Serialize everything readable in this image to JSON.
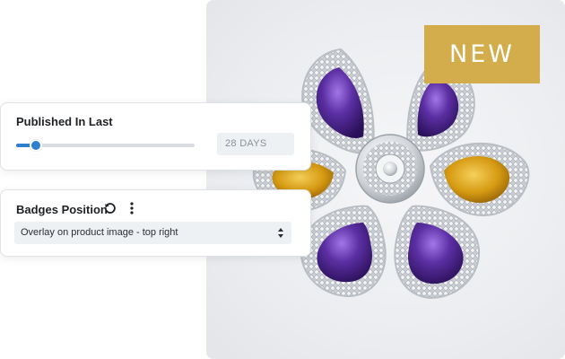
{
  "product": {
    "badge_text": "NEW"
  },
  "published_in_last": {
    "label": "Published In Last",
    "slider_value_fraction": 0.11,
    "value_text": "28 DAYS"
  },
  "badges_position": {
    "label": "Badges Position",
    "reset_icon": "reset-icon",
    "more_icon": "more-vertical-icon",
    "selected_option": "Overlay on product image - top right"
  },
  "colors": {
    "accent": "#2f7fd1",
    "badge_background": "#d3ad4c",
    "amethyst": "#5a2f9e",
    "citrine": "#d69a12"
  }
}
